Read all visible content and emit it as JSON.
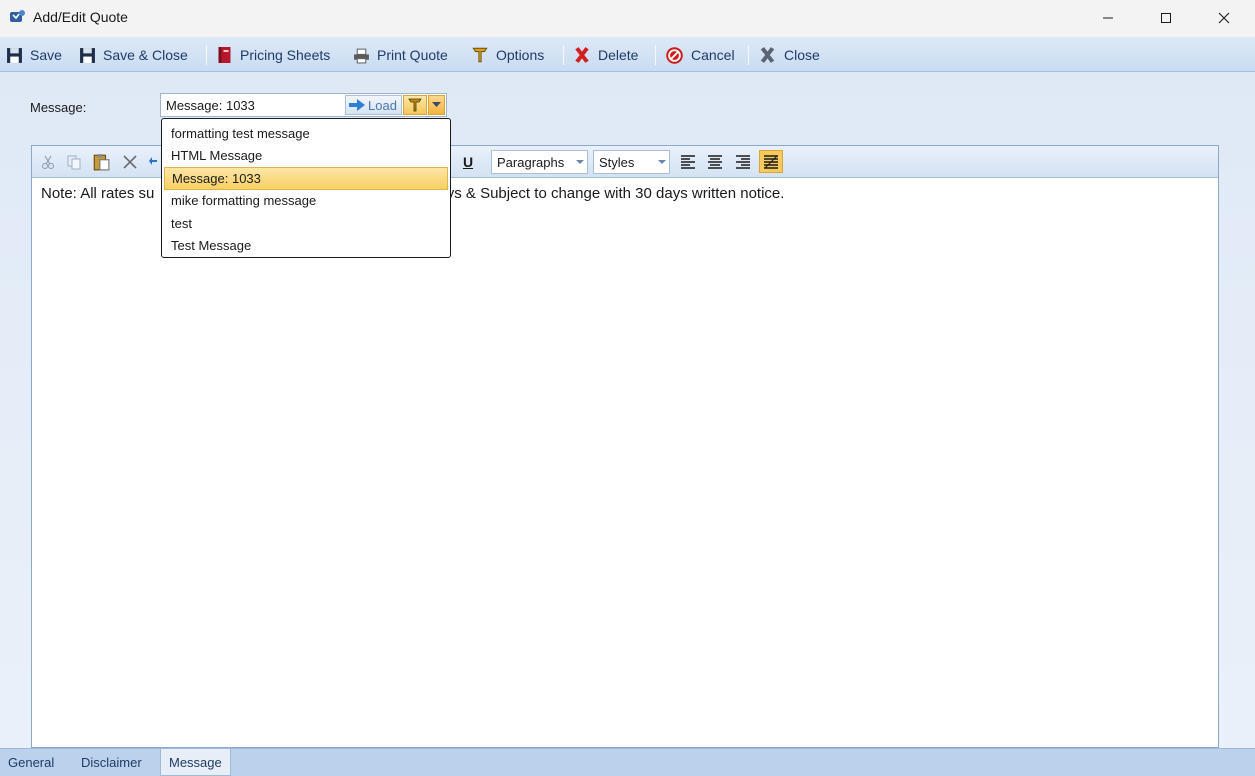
{
  "window": {
    "title": "Add/Edit Quote",
    "icon": "app-logo-icon"
  },
  "toolbar": {
    "save": "Save",
    "save_close": "Save & Close",
    "pricing_sheets": "Pricing Sheets",
    "print_quote": "Print Quote",
    "options": "Options",
    "delete": "Delete",
    "cancel": "Cancel",
    "close": "Close"
  },
  "message": {
    "label": "Message:",
    "selected_value": "Message: 1033",
    "load_label": "Load"
  },
  "dropdown": {
    "items": [
      "formatting test message",
      "HTML Message",
      "Message: 1033",
      "mike formatting message",
      "test",
      "Test Message"
    ],
    "selected_index": 2
  },
  "editor": {
    "paragraphs_label": "Paragraphs",
    "styles_label": "Styles",
    "underline_label": "U",
    "content_left": "Note: All rates su",
    "content_right": "ays & Subject to change with 30 days written notice."
  },
  "tabs": {
    "items": [
      "General",
      "Disclaimer",
      "Message"
    ],
    "active": "Message"
  },
  "colors": {
    "accent": "#f8cf63",
    "toolbar_text": "#1f3b66"
  }
}
